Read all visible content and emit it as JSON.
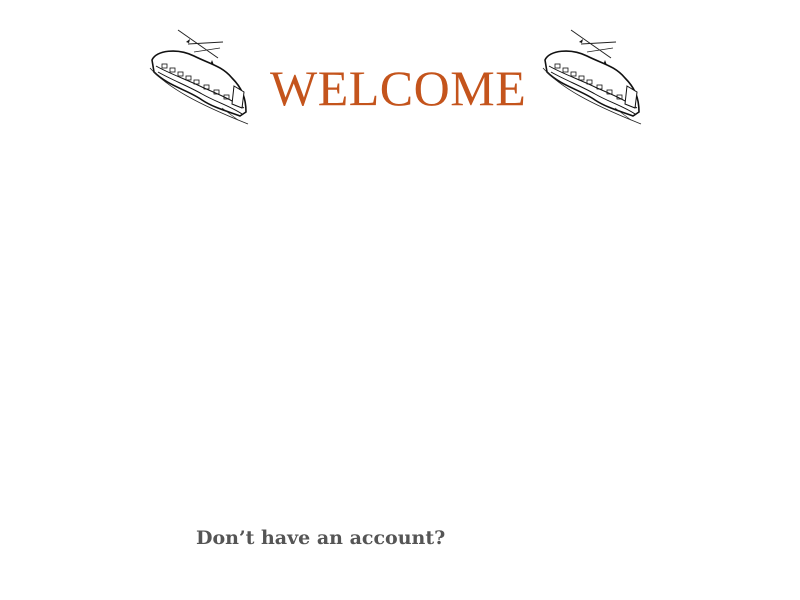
{
  "header": {
    "title": "WELCOME",
    "title_color": "#c4541c",
    "left_illustration": "train-illustration",
    "right_illustration": "train-illustration"
  },
  "footer": {
    "signup_prompt": "Don’t have an account?"
  }
}
